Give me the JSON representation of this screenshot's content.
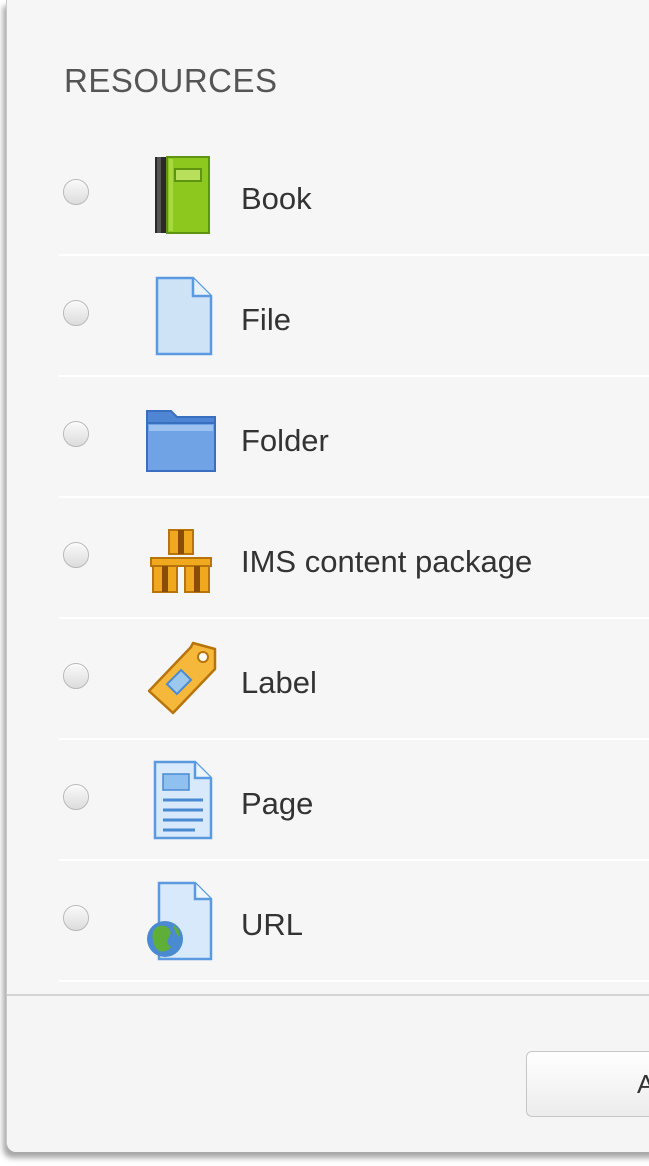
{
  "section": {
    "heading": "RESOURCES"
  },
  "modules": [
    {
      "label": "Book",
      "icon": "book-icon"
    },
    {
      "label": "File",
      "icon": "file-icon"
    },
    {
      "label": "Folder",
      "icon": "folder-icon"
    },
    {
      "label": "IMS content package",
      "icon": "ims-package-icon"
    },
    {
      "label": "Label",
      "icon": "label-tag-icon"
    },
    {
      "label": "Page",
      "icon": "page-icon"
    },
    {
      "label": "URL",
      "icon": "url-globe-icon"
    }
  ],
  "footer": {
    "add_button_label": "A"
  },
  "colors": {
    "heading": "#555555",
    "book_green": "#8cc81e",
    "file_blue": "#cfe3f7",
    "folder_blue": "#6fa3e6",
    "package_orange": "#f0a81e",
    "label_orange": "#f5b83a",
    "globe_green": "#5fae3a"
  }
}
